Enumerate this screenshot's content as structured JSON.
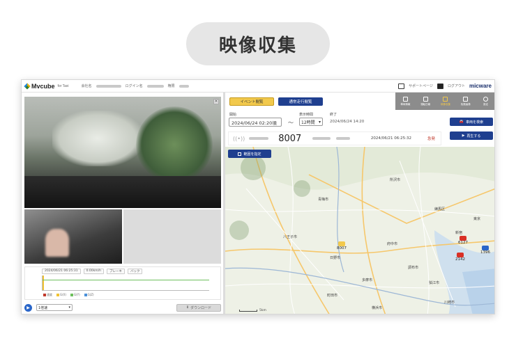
{
  "banner": {
    "title": "映像収集"
  },
  "header": {
    "logo": "Mvcube",
    "logo_sub": "for Taxi",
    "meta_labels": [
      "会社名",
      "ログイン名",
      "権限"
    ],
    "right_links": [
      "サポートページ",
      "ログアウト"
    ],
    "brand": "micware"
  },
  "toolbar": {
    "event_tab": "イベント閲覧",
    "normal_tab": "通常走行閲覧",
    "icons": [
      {
        "label": "車両情報",
        "icon": "vehicle-info-icon",
        "active": false
      },
      {
        "label": "運転日報",
        "icon": "report-icon",
        "active": false
      },
      {
        "label": "映像収集",
        "icon": "video-collect-icon",
        "active": true
      },
      {
        "label": "危険画像",
        "icon": "warning-icon",
        "active": false
      },
      {
        "label": "設定",
        "icon": "gear-icon",
        "active": false
      }
    ]
  },
  "filters": {
    "start_label": "開始",
    "start_value": "2024/06/24 02:20頃",
    "duration_label": "表示時間",
    "duration_value": "12時間",
    "end_label": "終了",
    "end_value": "2024/06/24 14:20",
    "search_vehicle": "車両を検索",
    "play": "再生する"
  },
  "vehicle": {
    "number": "8007",
    "timestamp": "2024/06/21 06:25:32",
    "status": "急発"
  },
  "map": {
    "area_button": "範囲を指定",
    "markers": [
      "8007",
      "6127",
      "2142",
      "1396"
    ],
    "places": [
      "青梅市",
      "八王子市",
      "町田市",
      "府中市",
      "調布市",
      "狛江市",
      "川崎市",
      "横浜市",
      "東京",
      "新宿",
      "練馬区",
      "所沢市",
      "日野市",
      "多摩市"
    ],
    "scale": "5km"
  },
  "graph": {
    "toolbar": [
      "2024/06/21 06:25:31",
      "0.00km/h",
      "ブレーキ",
      "バック"
    ],
    "legend": [
      "速度",
      "G(X)",
      "G(Y)",
      "G(Z)"
    ],
    "legend_colors": [
      "#c0392b",
      "#f1c232",
      "#6dbf5c",
      "#4a90d9"
    ]
  },
  "player": {
    "speed": "1倍速",
    "download": "ダウンロード"
  }
}
